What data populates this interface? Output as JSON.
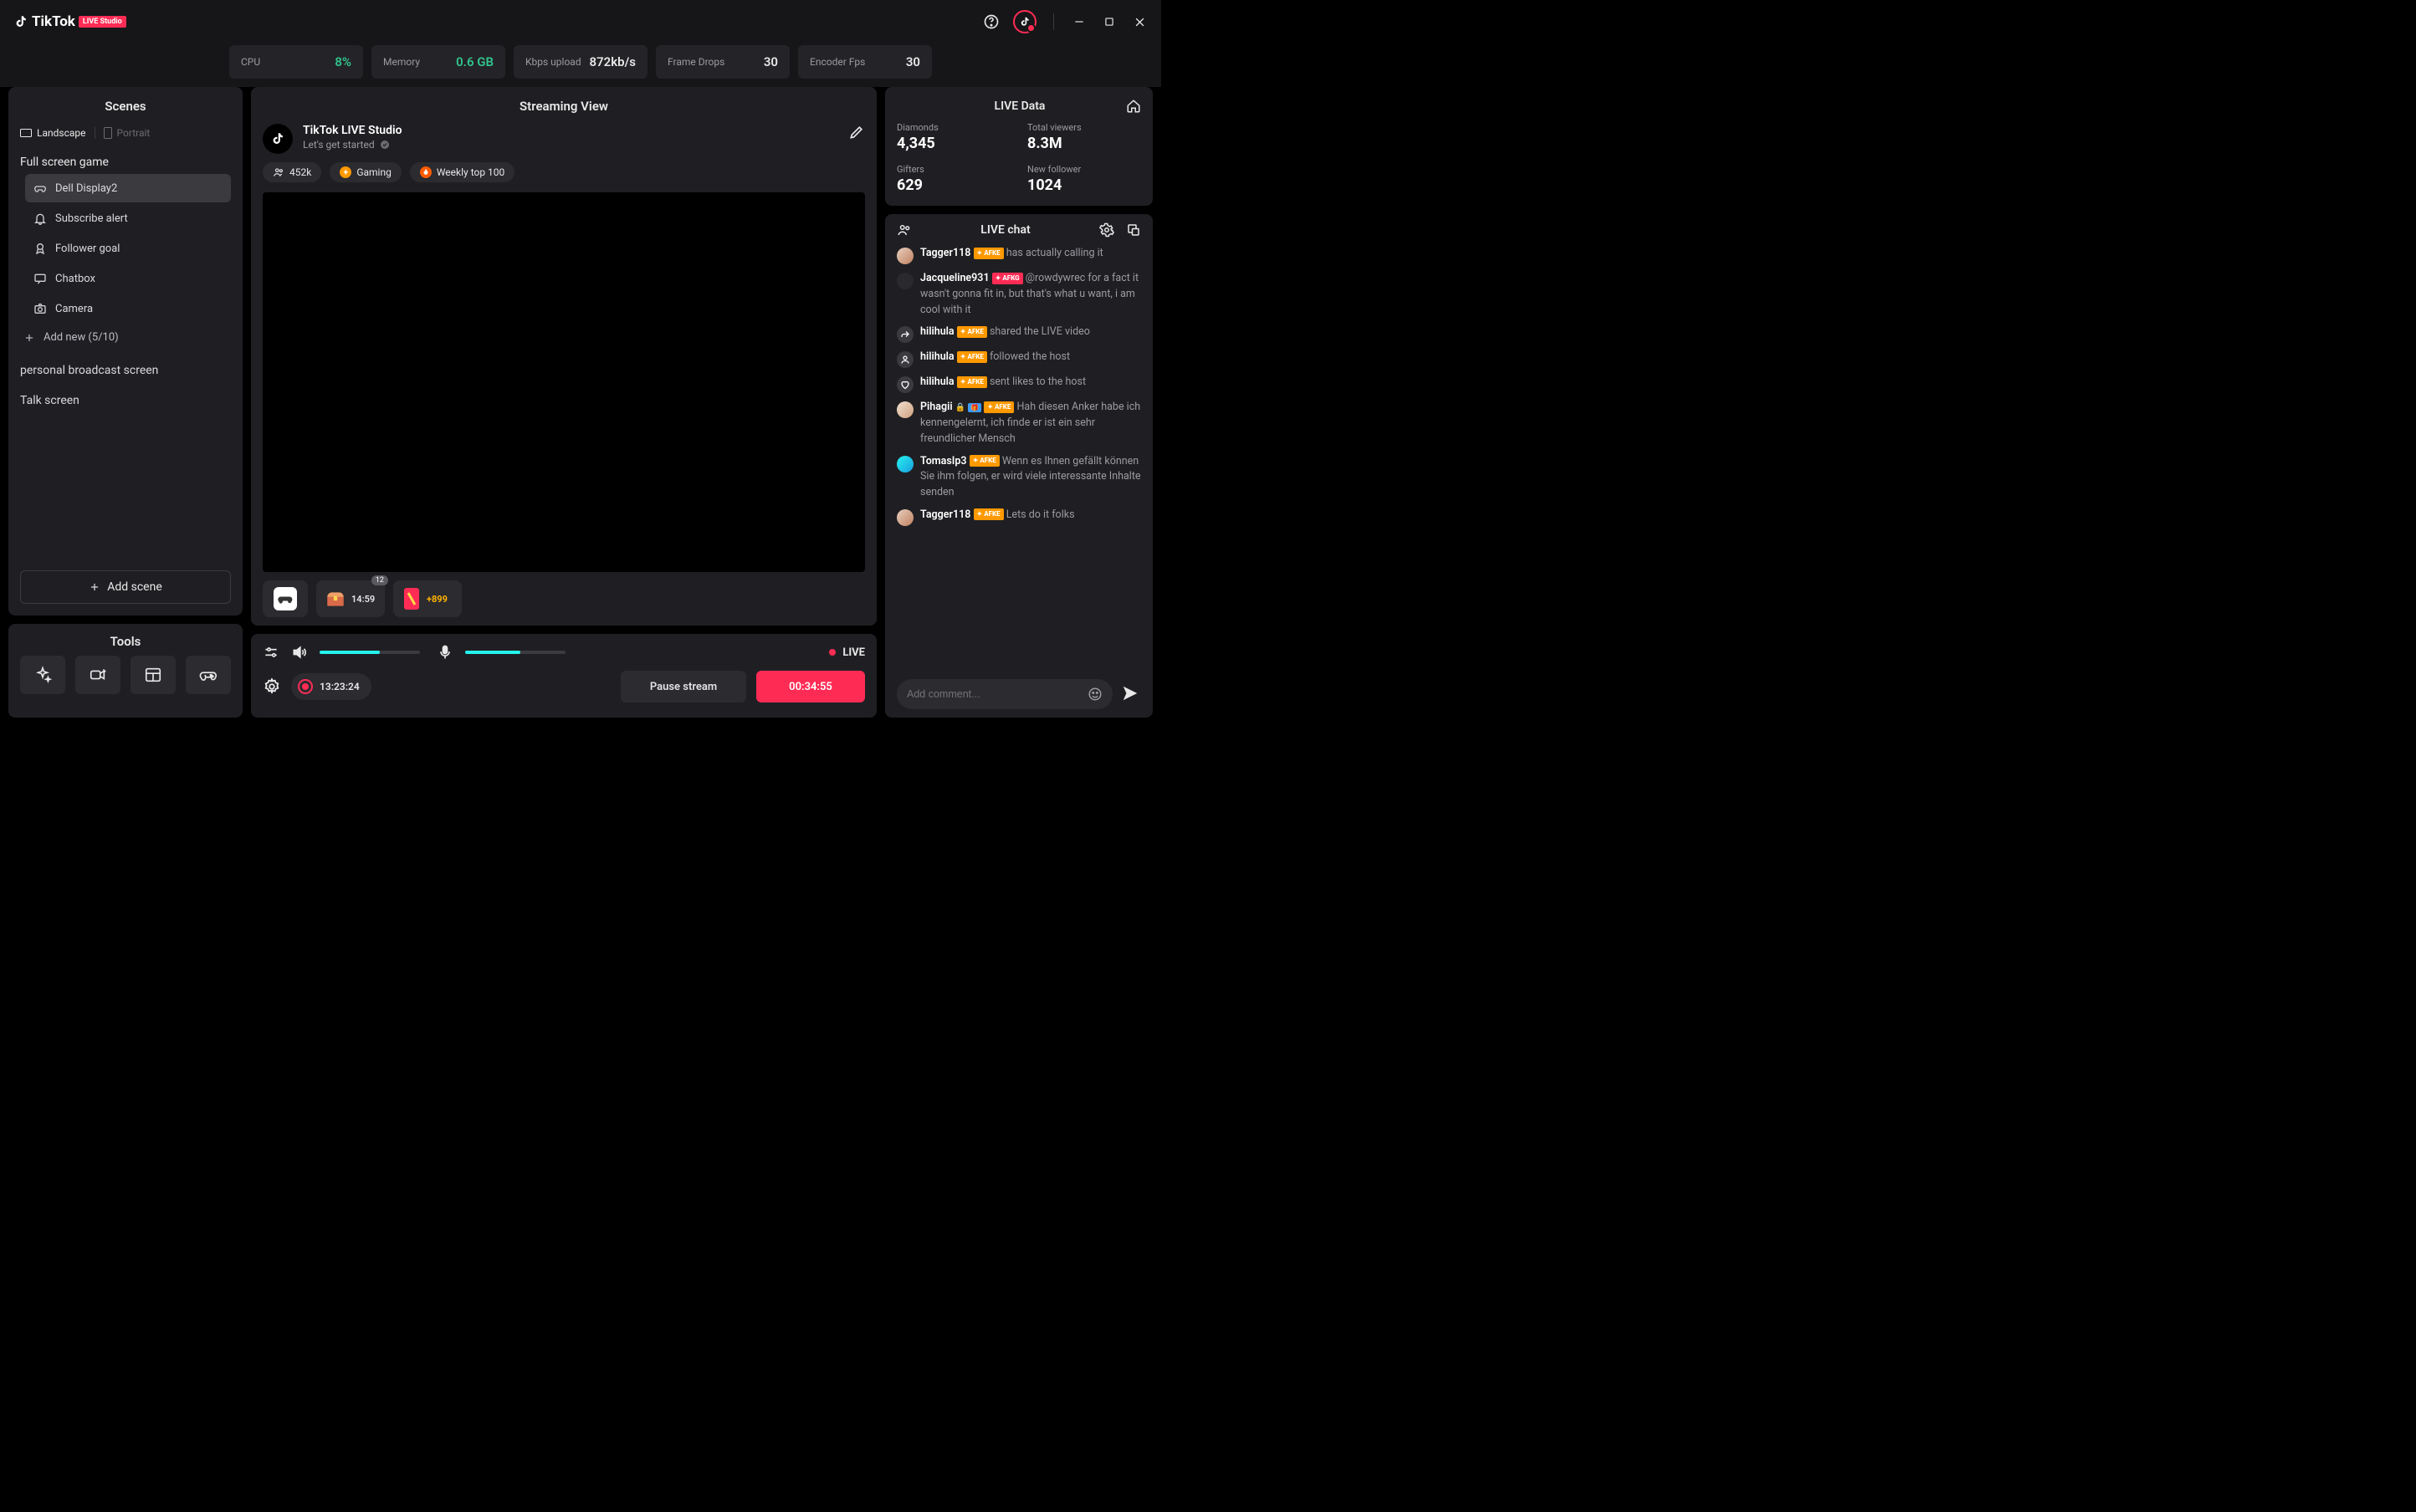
{
  "app": {
    "name": "TikTok",
    "badge": "LIVE Studio"
  },
  "stats": [
    {
      "label": "CPU",
      "value": "8%",
      "color": "green"
    },
    {
      "label": "Memory",
      "value": "0.6 GB",
      "color": "green"
    },
    {
      "label": "Kbps upload",
      "value": "872kb/s",
      "color": "white"
    },
    {
      "label": "Frame Drops",
      "value": "30",
      "color": "white"
    },
    {
      "label": "Encoder Fps",
      "value": "30",
      "color": "white"
    }
  ],
  "scenes": {
    "title": "Scenes",
    "orientation": {
      "landscape": "Landscape",
      "portrait": "Portrait"
    },
    "group_title": "Full screen game",
    "items": [
      {
        "id": "dell-display",
        "label": "Dell Display2",
        "active": true
      },
      {
        "id": "subscribe-alert",
        "label": "Subscribe alert",
        "active": false
      },
      {
        "id": "follower-goal",
        "label": "Follower goal",
        "active": false
      },
      {
        "id": "chatbox",
        "label": "Chatbox",
        "active": false
      },
      {
        "id": "camera",
        "label": "Camera",
        "active": false
      }
    ],
    "add_new": "Add new (5/10)",
    "others": [
      {
        "label": "personal broadcast screen"
      },
      {
        "label": "Talk screen"
      }
    ],
    "add_scene": "Add scene"
  },
  "tools": {
    "title": "Tools"
  },
  "streaming": {
    "title": "Streaming View",
    "app_title": "TikTok LIVE Studio",
    "subtitle": "Let's get started",
    "viewers": "452k",
    "chips": {
      "gaming": "Gaming",
      "weekly": "Weekly top 100"
    },
    "cards": {
      "chest_time": "14:59",
      "chest_badge": "12",
      "bonus": "+899"
    }
  },
  "controls": {
    "speaker_level": 60,
    "mic_level": 55,
    "live_label": "LIVE",
    "rec_time": "13:23:24",
    "pause_label": "Pause stream",
    "duration": "00:34:55"
  },
  "live_data": {
    "title": "LIVE Data",
    "stats": [
      {
        "label": "Diamonds",
        "value": "4,345"
      },
      {
        "label": "Total viewers",
        "value": "8.3M"
      },
      {
        "label": "Gifters",
        "value": "629"
      },
      {
        "label": "New follower",
        "value": "1024"
      }
    ]
  },
  "chat": {
    "title": "LIVE chat",
    "placeholder": "Add comment...",
    "messages": [
      {
        "user": "Tagger118",
        "badge": "AFKE",
        "badge_color": "orange",
        "text": "has actually calling it",
        "avatar": "grad1"
      },
      {
        "user": "Jacqueline931",
        "badge": "AFKG",
        "badge_color": "red",
        "text": "@rowdywrec for a fact it wasn't gonna fit in, but that's what u want, i am cool with it",
        "avatar": "dark"
      },
      {
        "user": "hilihula",
        "badge": "AFKE",
        "badge_color": "orange",
        "text": "shared the LIVE video",
        "avatar": "icon-share"
      },
      {
        "user": "hilihula",
        "badge": "AFKE",
        "badge_color": "orange",
        "text": "followed the host",
        "avatar": "icon-user"
      },
      {
        "user": "hilihula",
        "badge": "AFKE",
        "badge_color": "orange",
        "text": "sent likes to the host",
        "avatar": "icon-heart"
      },
      {
        "user": "Pihagii",
        "badge": "AFKE",
        "badge_color": "orange",
        "extras": [
          "lock",
          "gift"
        ],
        "text": "Hah diesen Anker habe ich kennengelernt, ich finde er ist ein sehr freundlicher Mensch",
        "avatar": "grad2"
      },
      {
        "user": "TomasIp3",
        "badge": "AFKE",
        "badge_color": "orange",
        "text": "Wenn es Ihnen gefällt können Sie ihm folgen, er wird viele interessante Inhalte senden",
        "avatar": "teal"
      },
      {
        "user": "Tagger118",
        "badge": "AFKE",
        "badge_color": "orange",
        "text": "Lets do it folks",
        "avatar": "grad1"
      }
    ]
  }
}
